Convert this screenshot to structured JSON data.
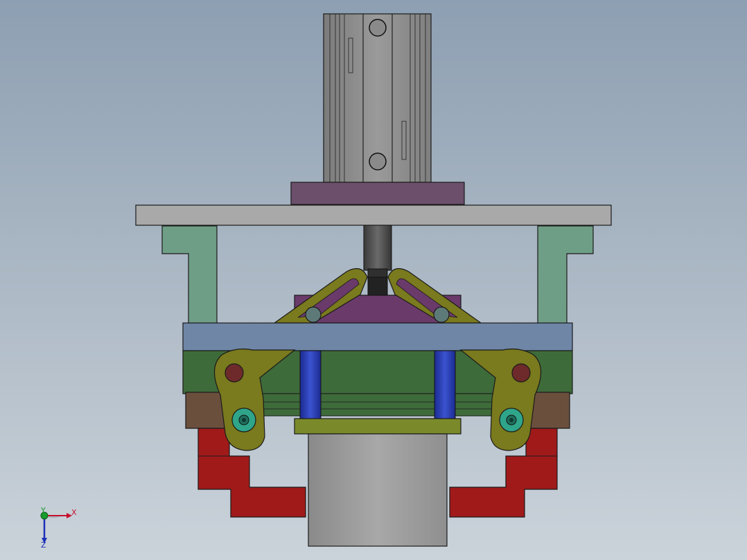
{
  "triad": {
    "x_label": "X",
    "y_label": "Y",
    "z_label": "Z",
    "x_color": "#c8102e",
    "y_color": "#1a9b2e",
    "z_color": "#1c2fb8"
  },
  "colors": {
    "cylinder_body": "#8c8c8c",
    "mount_block": "#6b4f6b",
    "top_plate": "#a9a9a9",
    "brackets": "#6f9e86",
    "cross_bar": "#6f86a6",
    "frame_green": "#3e6b3a",
    "purple_block": "#6a3a6a",
    "linkage_olive": "#7a7a1e",
    "guide_rods": "#2a3db0",
    "brown_blocks": "#6b4f3d",
    "gripper_jaws": "#a01a1a",
    "workpiece": "#9a9a9a"
  }
}
